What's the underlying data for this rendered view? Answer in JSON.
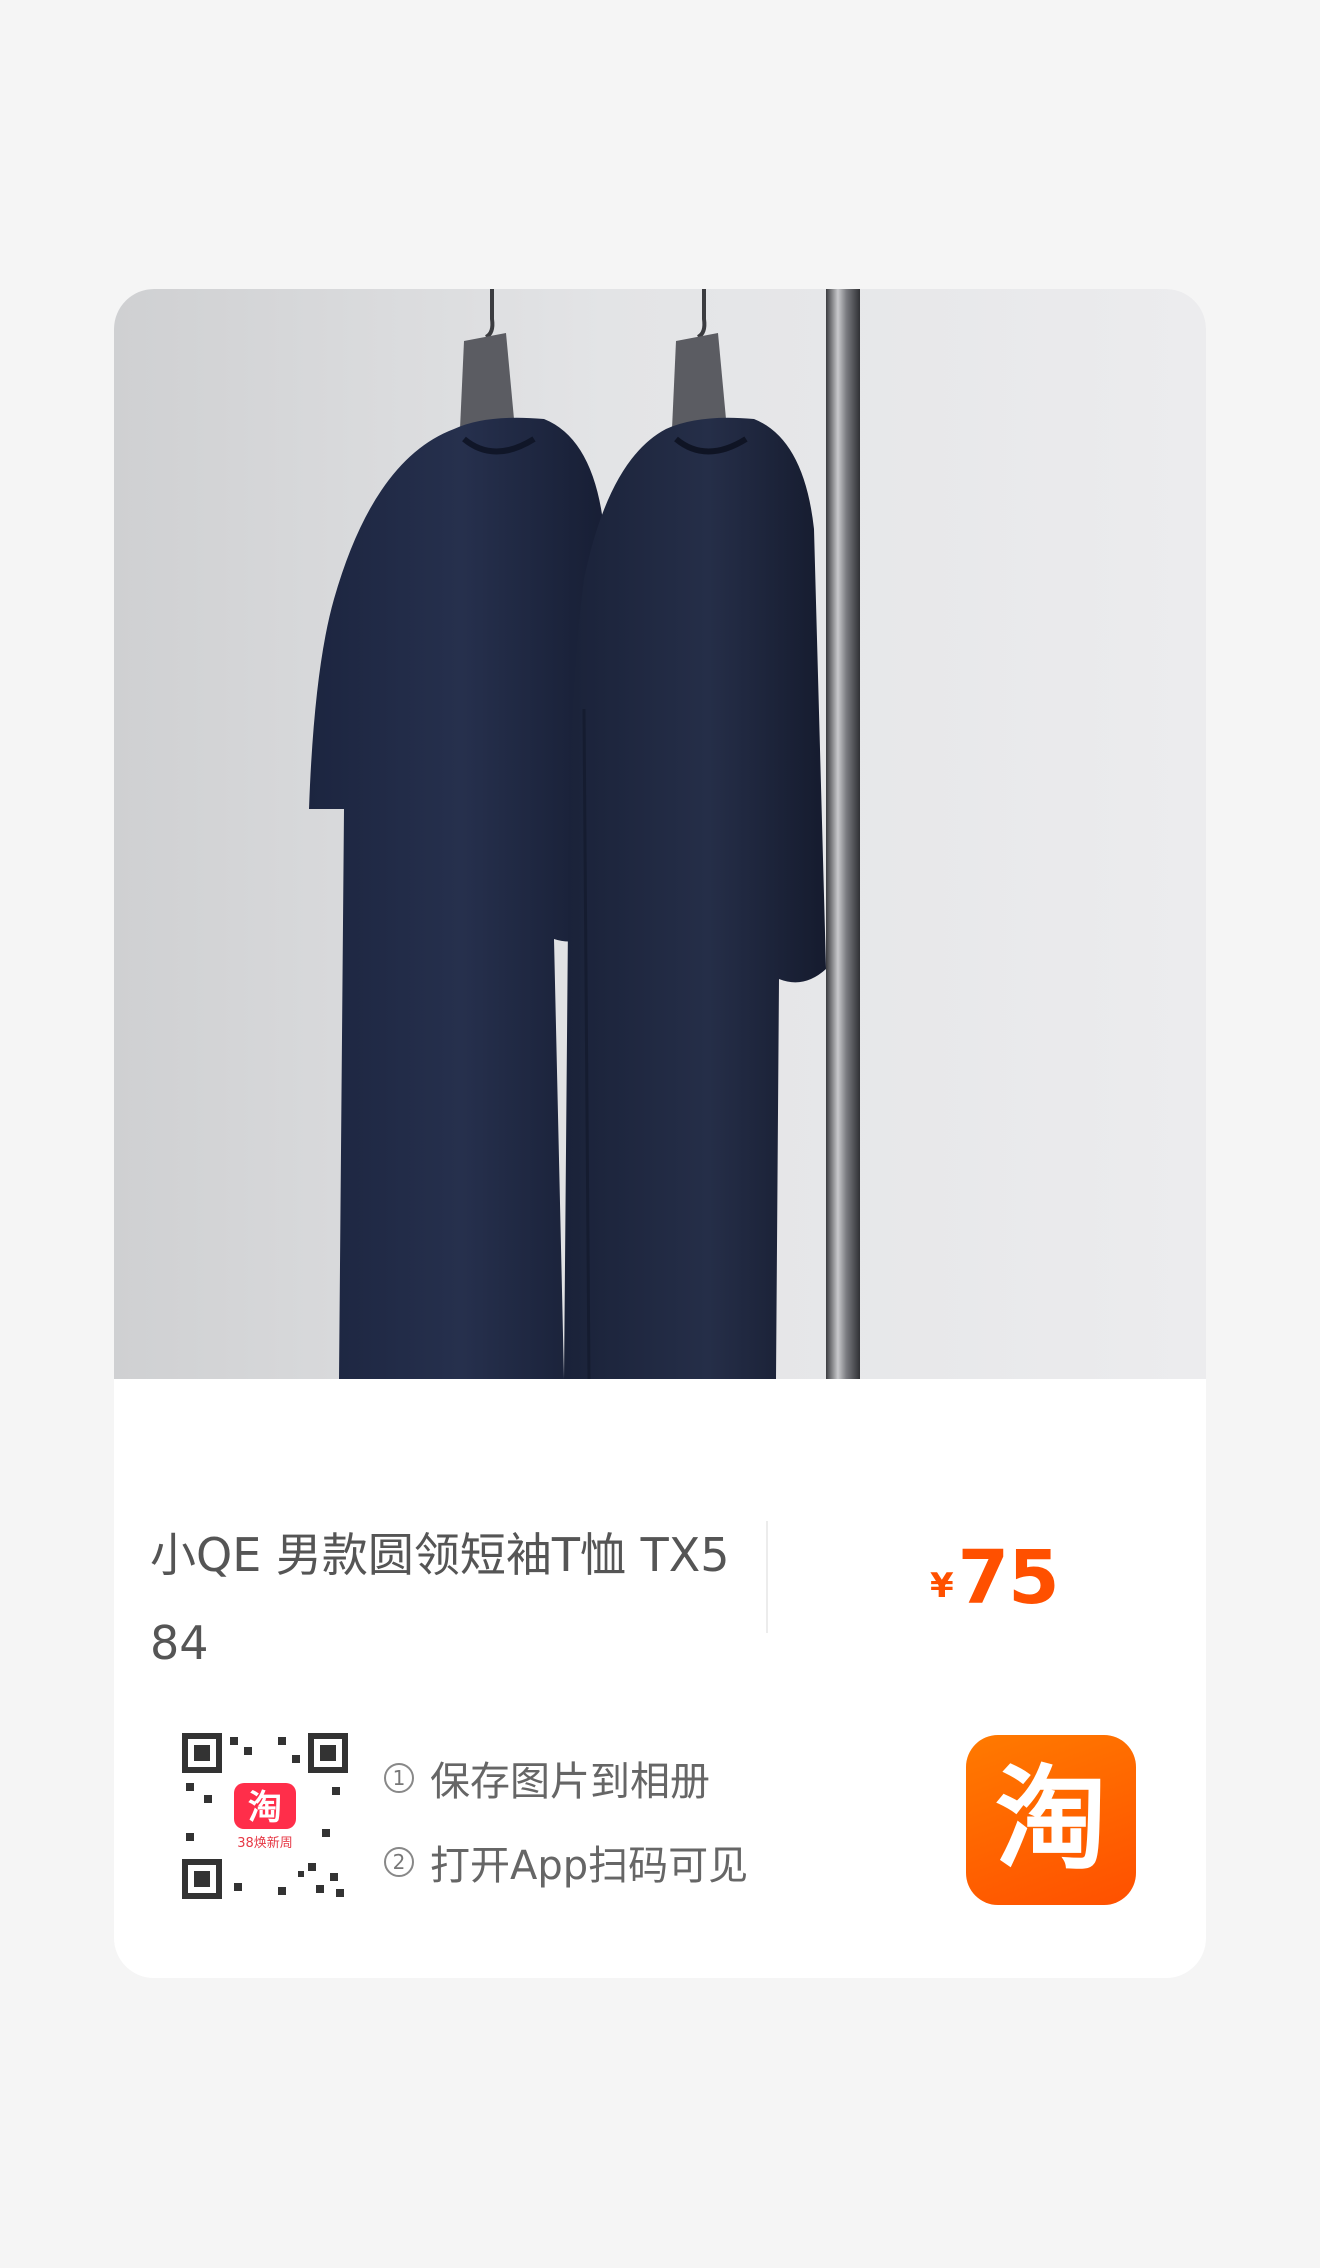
{
  "product": {
    "title": "小QE 男款圆领短袖T恤 TX584",
    "currency_symbol": "¥",
    "price": "75",
    "price_color": "#ff5000"
  },
  "share": {
    "qr_badge_text": "淘",
    "qr_badge_caption": "38焕新周",
    "step1_num": "1",
    "step1_text": "保存图片到相册",
    "step2_num": "2",
    "step2_text": "打开App扫码可见"
  },
  "app_logo": {
    "char": "淘",
    "icon": "taobao-logo-icon",
    "color": "#ff5000"
  }
}
